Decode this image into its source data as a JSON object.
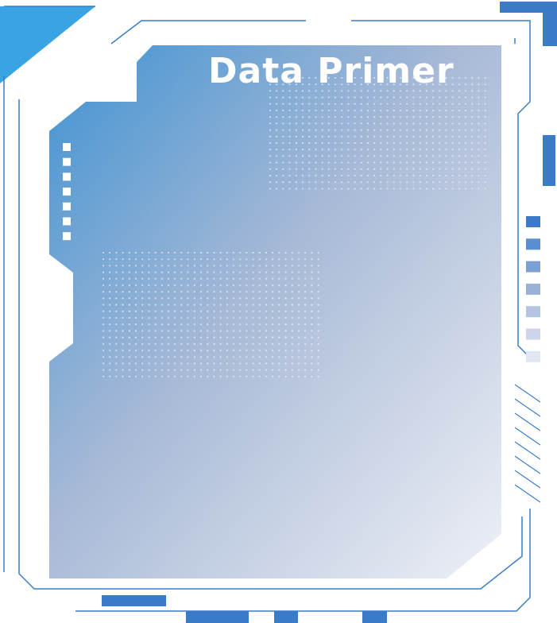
{
  "title": "Data Primer",
  "colors": {
    "frame_line": "#3b7cc9",
    "accent_block": "#3a7bc8",
    "corner_triangle": "#3aa3e3",
    "panel_gradient_start": "#3f92d2",
    "panel_gradient_mid": "#a7b9d6",
    "panel_gradient_end": "#eef0f6",
    "title_text": "#ffffff"
  },
  "decorations": {
    "left_square_count": 7,
    "right_square_count": 7,
    "right_stripe_count": 8,
    "bottom_block_count": 4
  }
}
